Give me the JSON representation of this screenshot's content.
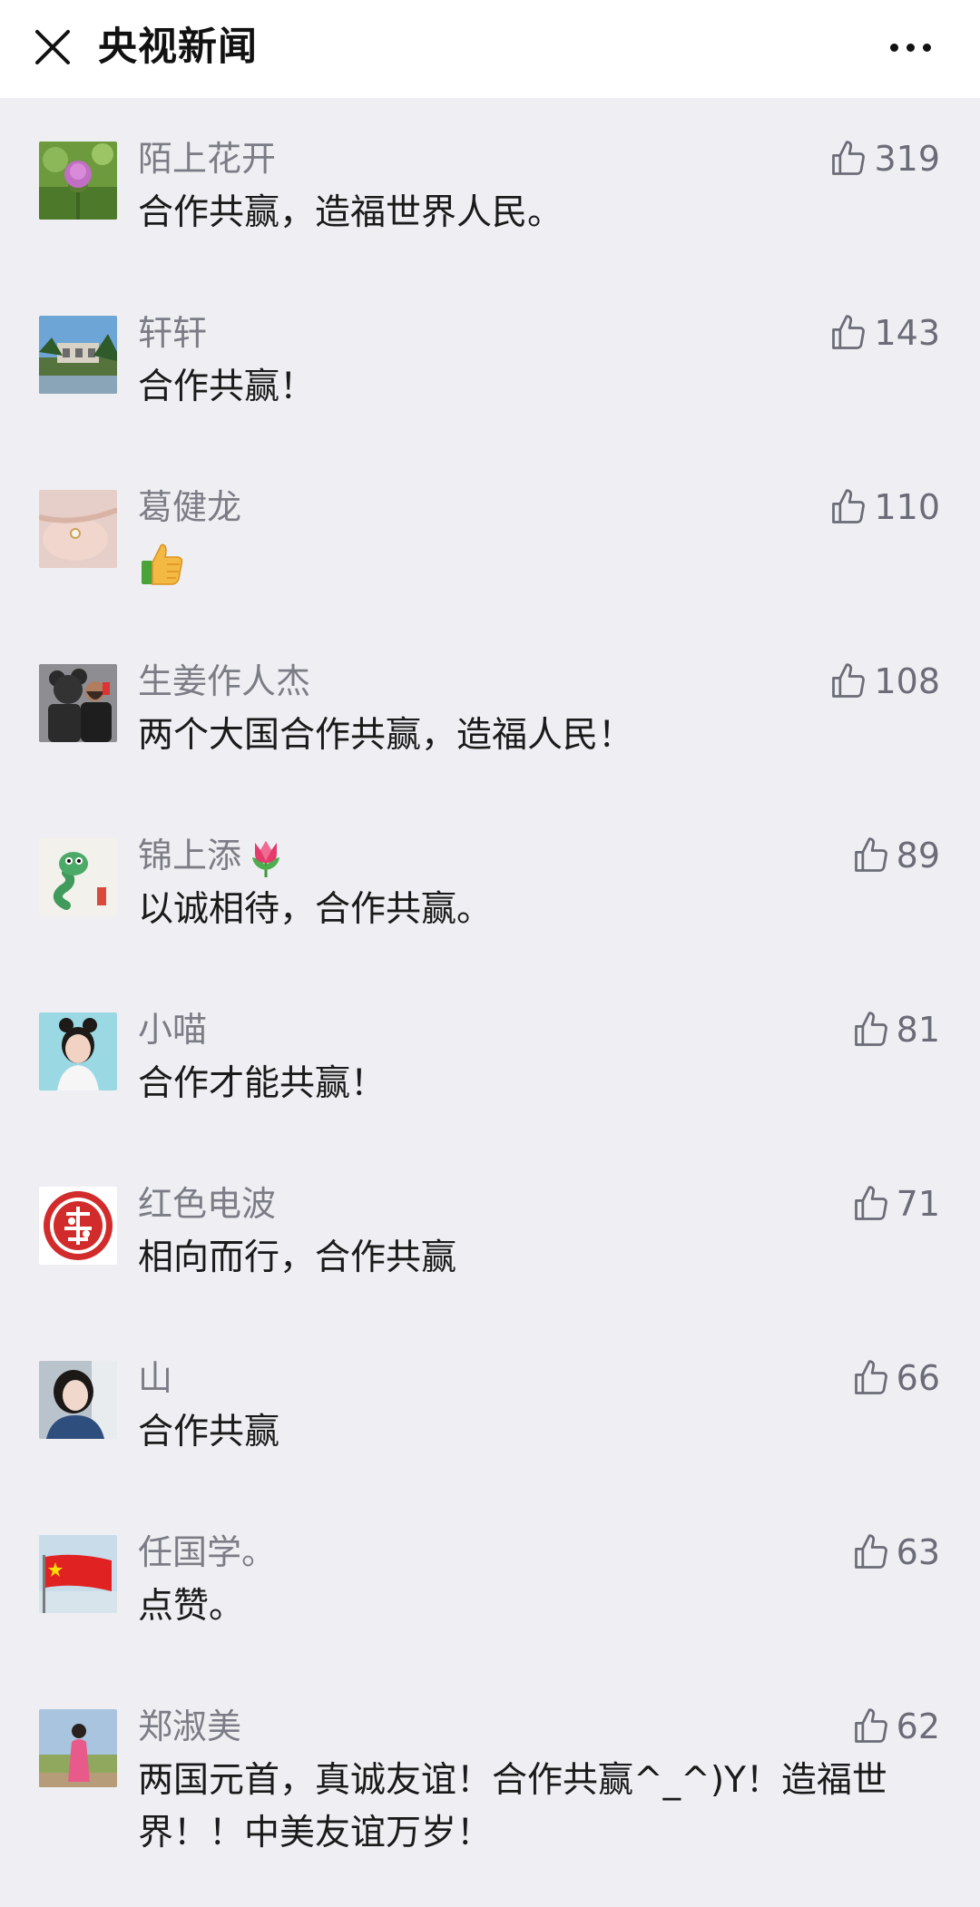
{
  "header": {
    "title": "央视新闻",
    "close_icon": "close-icon",
    "more_icon": "more-dots-icon"
  },
  "comments": [
    {
      "nickname": "陌上花开",
      "text": "合作共赢，造福世界人民。",
      "likes": "319",
      "avatar": "thistle-flower-photo"
    },
    {
      "nickname": "轩轩",
      "text": "合作共赢！",
      "likes": "143",
      "avatar": "landscape-building-photo"
    },
    {
      "nickname": "葛健龙",
      "text": "",
      "text_emoji": "thumbs-up-emoji",
      "likes": "110",
      "avatar": "hand-with-ring-photo"
    },
    {
      "nickname": "生姜作人杰",
      "text": "两个大国合作共赢，造福人民！",
      "likes": "108",
      "avatar": "man-with-bear-photo"
    },
    {
      "nickname": "锦上添",
      "nickname_emoji": "tulip-emoji",
      "text": "以诚相待，合作共赢。",
      "likes": "89",
      "avatar": "cartoon-snake-avatar"
    },
    {
      "nickname": "小喵",
      "text": "合作才能共赢！",
      "likes": "81",
      "avatar": "girl-portrait-photo"
    },
    {
      "nickname": "红色电波",
      "text": "相向而行，合作共赢",
      "likes": "71",
      "avatar": "red-paper-cut-fu-avatar"
    },
    {
      "nickname": "山",
      "text": "合作共赢",
      "likes": "66",
      "avatar": "woman-portrait-photo"
    },
    {
      "nickname": "任国学。",
      "text": "点赞。",
      "likes": "63",
      "avatar": "chinese-flag-avatar"
    },
    {
      "nickname": "郑淑美",
      "text": "两国元首，真诚友谊！合作共赢^_^)Y！造福世界！！中美友谊万岁！",
      "likes": "62",
      "avatar": "woman-in-pink-photo"
    }
  ],
  "colors": {
    "background": "#efeff3",
    "topbar": "#ffffff",
    "nickname": "#7c7c86",
    "comment_text": "#1a1a1a",
    "like_count": "#6c6c78"
  }
}
